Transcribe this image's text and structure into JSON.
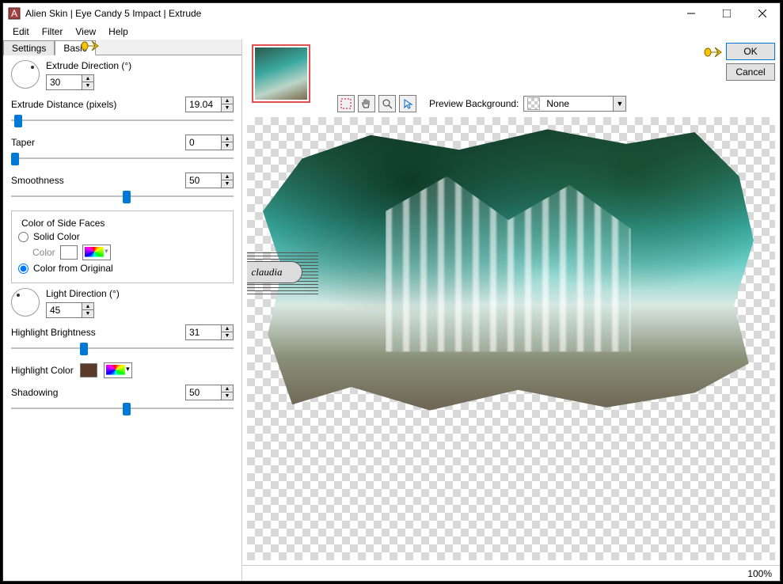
{
  "window": {
    "title": "Alien Skin | Eye Candy 5 Impact | Extrude"
  },
  "menu": {
    "edit": "Edit",
    "filter": "Filter",
    "view": "View",
    "help": "Help"
  },
  "tabs": {
    "settings": "Settings",
    "basic": "Basic"
  },
  "params": {
    "extrude_direction_label": "Extrude Direction (°)",
    "extrude_direction_value": "30",
    "extrude_distance_label": "Extrude Distance (pixels)",
    "extrude_distance_value": "19.04",
    "taper_label": "Taper",
    "taper_value": "0",
    "smoothness_label": "Smoothness",
    "smoothness_value": "50",
    "side_faces_legend": "Color of Side Faces",
    "solid_color_label": "Solid Color",
    "color_label": "Color",
    "color_from_original_label": "Color from Original",
    "light_direction_label": "Light Direction (°)",
    "light_direction_value": "45",
    "highlight_brightness_label": "Highlight Brightness",
    "highlight_brightness_value": "31",
    "highlight_color_label": "Highlight Color",
    "highlight_color_value": "#5a3a28",
    "shadowing_label": "Shadowing",
    "shadowing_value": "50"
  },
  "buttons": {
    "ok": "OK",
    "cancel": "Cancel"
  },
  "preview": {
    "bg_label": "Preview Background:",
    "bg_value": "None"
  },
  "watermark": "claudia",
  "status": {
    "zoom": "100%"
  }
}
